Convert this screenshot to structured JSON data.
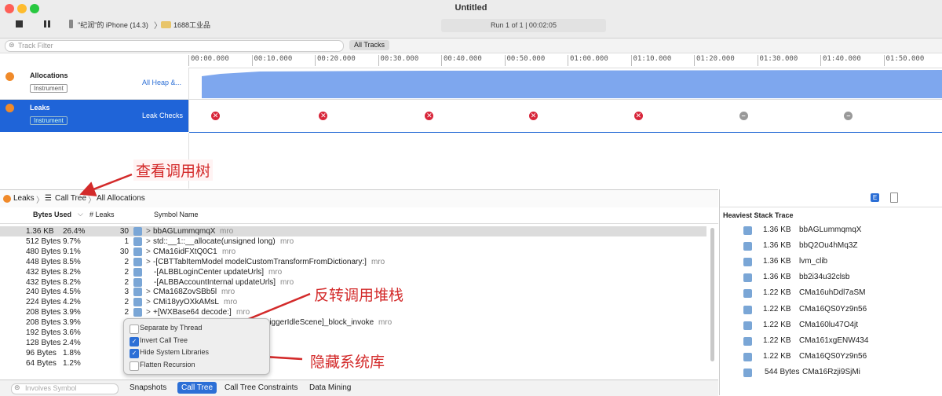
{
  "window": {
    "title": "Untitled",
    "run_status": "Run 1 of 1 | 00:02:05"
  },
  "toolbar": {
    "device": "\"纪润\"的 iPhone (14.3)",
    "target": "1688工业品"
  },
  "filter": {
    "placeholder": "Track Filter",
    "all_tracks": "All Tracks"
  },
  "timeline": {
    "ticks": [
      "00:00.000",
      "00:10.000",
      "00:20.000",
      "00:30.000",
      "00:40.000",
      "00:50.000",
      "01:00.000",
      "01:10.000",
      "01:20.000",
      "01:30.000",
      "01:40.000",
      "01:50.000"
    ]
  },
  "tracks": [
    {
      "name": "Allocations",
      "badge": "Instrument",
      "detail": "All Heap &..."
    },
    {
      "name": "Leaks",
      "badge": "Instrument",
      "detail": "Leak Checks"
    }
  ],
  "leak_markers": [
    {
      "t": 0.29,
      "kind": "leak"
    },
    {
      "t": 1.44,
      "kind": "leak"
    },
    {
      "t": 2.57,
      "kind": "leak"
    },
    {
      "t": 3.68,
      "kind": "leak"
    },
    {
      "t": 4.8,
      "kind": "leak"
    },
    {
      "t": 5.92,
      "kind": "none"
    },
    {
      "t": 7.04,
      "kind": "none"
    }
  ],
  "colors": {
    "accent": "#2c6fd6",
    "selected_track": "#1f64d8",
    "leak_red": "#d8263a",
    "allocation_fill": "#7ea7ee",
    "callout_red": "#d32a2a"
  },
  "breadcrumb": {
    "leaks": "Leaks",
    "call_tree": "Call Tree",
    "all_allocations": "All Allocations"
  },
  "columns": {
    "bytes_used": "Bytes Used",
    "leaks": "# Leaks",
    "symbol": "Symbol Name"
  },
  "rows": [
    {
      "bytes": "1.36 KB",
      "pct": "26.4%",
      "leaks": "30",
      "symbol": "bbAGLummqmqX",
      "mro": "mro",
      "arrow": true
    },
    {
      "bytes": "512 Bytes",
      "pct": "9.7%",
      "leaks": "1",
      "symbol": "std::__1::__allocate(unsigned long)",
      "mro": "mro",
      "arrow": true
    },
    {
      "bytes": "480 Bytes",
      "pct": "9.1%",
      "leaks": "30",
      "symbol": "CMa16idFXtQ0C1",
      "mro": "mro",
      "arrow": true
    },
    {
      "bytes": "448 Bytes",
      "pct": "8.5%",
      "leaks": "2",
      "symbol": "-[CBTTabItemModel modelCustomTransformFromDictionary:]",
      "mro": "mro",
      "arrow": true
    },
    {
      "bytes": "432 Bytes",
      "pct": "8.2%",
      "leaks": "2",
      "symbol": "-[ALBBLoginCenter updateUrls]",
      "mro": "mro",
      "arrow": false
    },
    {
      "bytes": "432 Bytes",
      "pct": "8.2%",
      "leaks": "2",
      "symbol": "-[ALBBAccountInternal updateUrls]",
      "mro": "mro",
      "arrow": false
    },
    {
      "bytes": "240 Bytes",
      "pct": "4.5%",
      "leaks": "3",
      "symbol": "CMa168ZovSBb5l",
      "mro": "mro",
      "arrow": true
    },
    {
      "bytes": "224 Bytes",
      "pct": "4.2%",
      "leaks": "2",
      "symbol": "CMi18yyOXkAMsL",
      "mro": "mro",
      "arrow": true
    },
    {
      "bytes": "208 Bytes",
      "pct": "3.9%",
      "leaks": "2",
      "symbol": "+[WXBase64 decode:]",
      "mro": "mro",
      "arrow": true
    },
    {
      "bytes": "208 Bytes",
      "pct": "3.9%",
      "leaks": "",
      "symbol": "riggerIdleScene]_block_invoke",
      "mro": "mro",
      "arrow": false
    },
    {
      "bytes": "192 Bytes",
      "pct": "3.6%",
      "leaks": "",
      "symbol": "",
      "mro": "",
      "arrow": false
    },
    {
      "bytes": "128 Bytes",
      "pct": "2.4%",
      "leaks": "",
      "symbol": "",
      "mro": "",
      "arrow": false
    },
    {
      "bytes": "96 Bytes",
      "pct": "1.8%",
      "leaks": "",
      "symbol": "",
      "mro": "",
      "arrow": false
    },
    {
      "bytes": "64 Bytes",
      "pct": "1.2%",
      "leaks": "",
      "symbol": "",
      "mro": "",
      "arrow": false
    }
  ],
  "popup": {
    "options": [
      {
        "label": "Separate by Thread",
        "checked": false
      },
      {
        "label": "Invert Call Tree",
        "checked": true
      },
      {
        "label": "Hide System Libraries",
        "checked": true
      },
      {
        "label": "Flatten Recursion",
        "checked": false
      }
    ]
  },
  "annotations": {
    "view_call_tree": "查看调用树",
    "invert_stack": "反转调用堆栈",
    "hide_system": "隐藏系统库"
  },
  "heaviest": {
    "title": "Heaviest Stack Trace",
    "items": [
      {
        "bytes": "1.36 KB",
        "symbol": "bbAGLummqmqX"
      },
      {
        "bytes": "1.36 KB",
        "symbol": "bbQ2Ou4hMq3Z"
      },
      {
        "bytes": "1.36 KB",
        "symbol": "lvm_clib"
      },
      {
        "bytes": "1.36 KB",
        "symbol": "bb2i34u32clsb"
      },
      {
        "bytes": "1.22 KB",
        "symbol": "CMa16uhDdl7aSM"
      },
      {
        "bytes": "1.22 KB",
        "symbol": "CMa16QS0Yz9n56"
      },
      {
        "bytes": "1.22 KB",
        "symbol": "CMa160lu47O4jt"
      },
      {
        "bytes": "1.22 KB",
        "symbol": "CMa161xgENW434"
      },
      {
        "bytes": "1.22 KB",
        "symbol": "CMa16QS0Yz9n56"
      },
      {
        "bytes": "544 Bytes",
        "symbol": "CMa16Rzji9SjMi"
      }
    ]
  },
  "bottom": {
    "symbol_placeholder": "Involves Symbol",
    "tabs": [
      "Snapshots",
      "Call Tree",
      "Call Tree Constraints",
      "Data Mining"
    ],
    "active_tab": 1
  }
}
